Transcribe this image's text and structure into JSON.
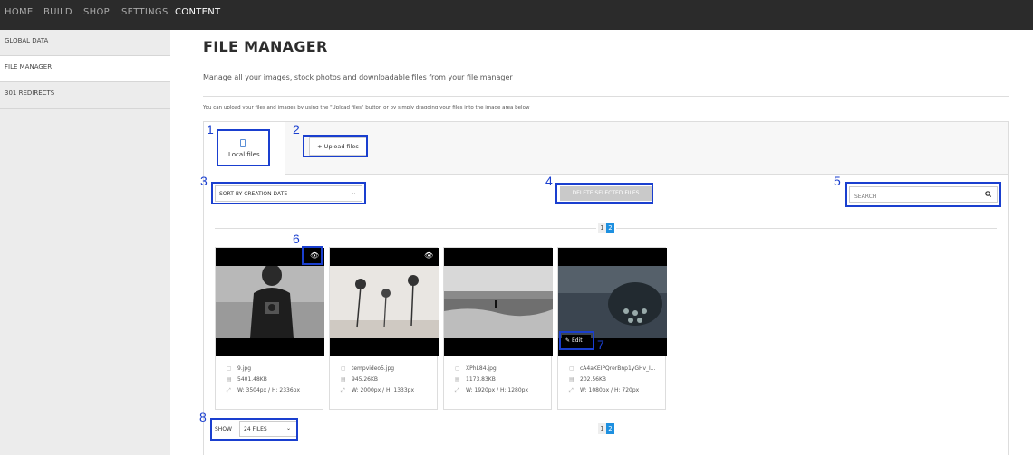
{
  "topnav": [
    "HOME",
    "BUILD",
    "SHOP",
    "SETTINGS",
    "CONTENT"
  ],
  "sidebar": {
    "items": [
      {
        "label": "GLOBAL DATA"
      },
      {
        "label": "FILE MANAGER"
      },
      {
        "label": "301 REDIRECTS"
      }
    ]
  },
  "page": {
    "title": "FILE MANAGER",
    "subtitle": "Manage all your images, stock photos and downloadable files from your file manager",
    "hint": "You can upload your files and images by using the \"Upload files\" button or by simply dragging your files into the image area below"
  },
  "tabs": {
    "local_files": "Local files",
    "upload": "+ Upload files"
  },
  "toolbar": {
    "sort": "SORT BY CREATION DATE",
    "delete": "DELETE SELECTED FILES",
    "search_placeholder": "SEARCH"
  },
  "pagination": {
    "pages": [
      "1",
      "2"
    ],
    "current": "2"
  },
  "files": [
    {
      "name": "9.jpg",
      "size": "5401.48KB",
      "dims": "W: 3504px / H: 2336px"
    },
    {
      "name": "tempvideo5.jpg",
      "size": "945.26KB",
      "dims": "W: 2000px / H: 1333px"
    },
    {
      "name": "XPhL84.jpg",
      "size": "1173.83KB",
      "dims": "W: 1920px / H: 1280px"
    },
    {
      "name": "cA4aKEIPQrerBnp1yGHv_I...",
      "size": "202.56KB",
      "dims": "W: 1080px / H: 720px"
    }
  ],
  "edit_label": "Edit",
  "show": {
    "label": "SHOW",
    "value": "24 FILES"
  },
  "callouts": [
    "1",
    "2",
    "3",
    "4",
    "5",
    "6",
    "7",
    "8"
  ],
  "colors": {
    "callout": "#1a3fcf",
    "page_active": "#1e90e0",
    "topbar": "#2b2b2b"
  }
}
